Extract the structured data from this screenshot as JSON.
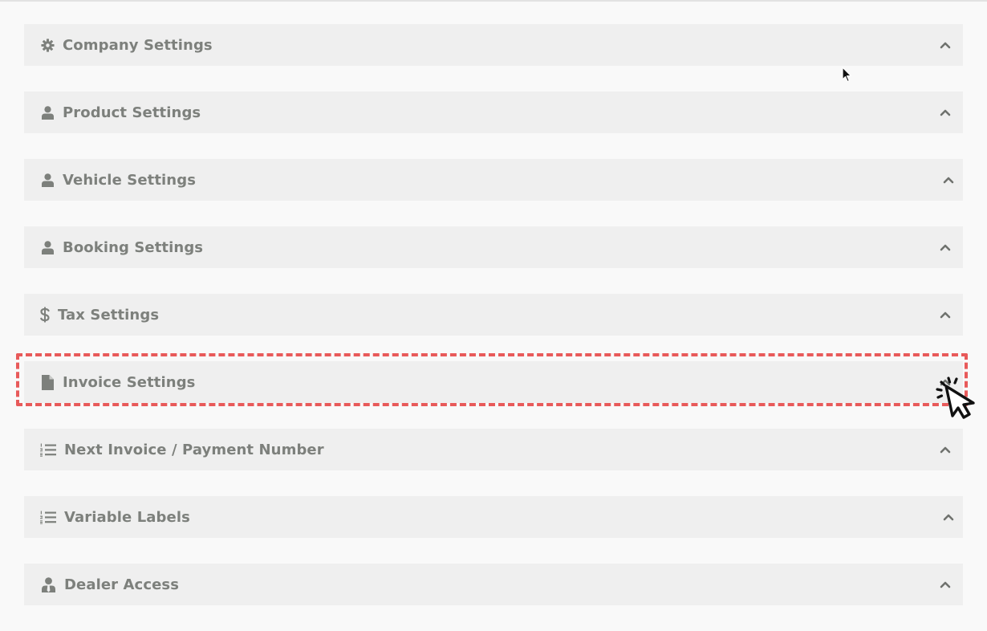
{
  "panels": [
    {
      "label": "Company Settings",
      "icon": "gear-icon"
    },
    {
      "label": "Product Settings",
      "icon": "user-icon"
    },
    {
      "label": "Vehicle Settings",
      "icon": "user-icon"
    },
    {
      "label": "Booking Settings",
      "icon": "user-icon"
    },
    {
      "label": "Tax Settings",
      "icon": "dollar-icon"
    },
    {
      "label": "Invoice Settings",
      "icon": "file-icon"
    },
    {
      "label": "Next Invoice / Payment Number",
      "icon": "ordered-list-icon"
    },
    {
      "label": "Variable Labels",
      "icon": "ordered-list-icon"
    },
    {
      "label": "Dealer Access",
      "icon": "user-tie-icon"
    }
  ],
  "colors": {
    "page_bg": "#f9f9f9",
    "panel_bg": "#efefef",
    "text": "#7d807c",
    "highlight": "#e85a5a"
  }
}
